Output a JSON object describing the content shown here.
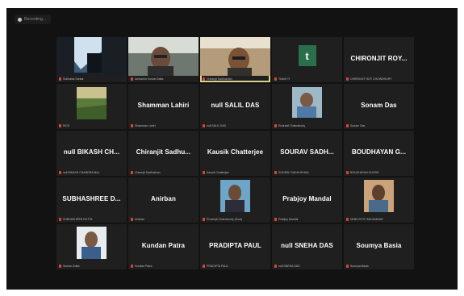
{
  "recording": {
    "label": "Recording..."
  },
  "tiles": [
    {
      "type": "video",
      "kind": "sky",
      "caption": "Subhasis Sarkar"
    },
    {
      "type": "video",
      "kind": "person1",
      "caption": "Ambarish Kumar Datta",
      "speaking": false
    },
    {
      "type": "video",
      "kind": "person2",
      "caption": "Chiranjit Sadhukhan",
      "speaking": true
    },
    {
      "type": "logo",
      "letter": "t",
      "caption": "Thanh Tr"
    },
    {
      "type": "name",
      "name": "CHIRONJIT ROY...",
      "caption": "CHIRONJIT ROY CHOWDHURY"
    },
    {
      "type": "video",
      "kind": "field",
      "caption": "RICK"
    },
    {
      "type": "name",
      "name": "Shamman Lahiri",
      "caption": "Shamman Lahiri"
    },
    {
      "type": "name",
      "name": "null SALIL DAS",
      "caption": "null SALIL DAS"
    },
    {
      "type": "video",
      "kind": "person3",
      "caption": "Rudranil Chakraborty"
    },
    {
      "type": "name",
      "name": "Sonam Das",
      "caption": "Sonam Das"
    },
    {
      "type": "name",
      "name": "null BIKASH CH...",
      "caption": "null BIKASH CHANDRA MAL"
    },
    {
      "type": "name",
      "name": "Chiranjit Sadhu...",
      "caption": "Chiranjit Sadhukhan"
    },
    {
      "type": "name",
      "name": "Kausik Chatterjee",
      "caption": "Kausik Chatterjee"
    },
    {
      "type": "name",
      "name": "SOURAV SADH...",
      "caption": "SOURAV SADHUKHAN"
    },
    {
      "type": "name",
      "name": "BOUDHAYAN G...",
      "caption": "BOUDHAYAN GHOSH"
    },
    {
      "type": "name",
      "name": "SUBHASHREE D...",
      "caption": "SUBHASHREE DUTTA"
    },
    {
      "type": "name",
      "name": "Anirban",
      "caption": "Anirban"
    },
    {
      "type": "video",
      "kind": "person4",
      "caption": "Prosenjit Chakraborty (Host)"
    },
    {
      "type": "name",
      "name": "Prabjoy Mandal",
      "caption": "Prabjoy Mandal"
    },
    {
      "type": "video",
      "kind": "person5",
      "caption": "DEBOJYOTI MAJUMDAR"
    },
    {
      "type": "video",
      "kind": "person6",
      "caption": "Suman Dutta"
    },
    {
      "type": "name",
      "name": "Kundan Patra",
      "caption": "Kundan Patra"
    },
    {
      "type": "name",
      "name": "PRADIPTA PAUL",
      "caption": "PRADIPTA PAUL"
    },
    {
      "type": "name",
      "name": "null SNEHA DAS",
      "caption": "null SNEHA DAS"
    },
    {
      "type": "name",
      "name": "Soumya Basia",
      "caption": "Soumya Basia"
    }
  ]
}
